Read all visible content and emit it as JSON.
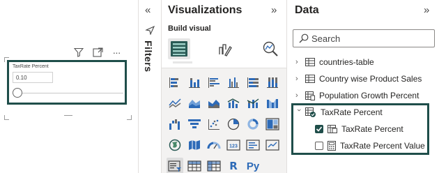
{
  "canvas": {
    "slicer_title": "TaxRate Percent",
    "slicer_value": "0.10",
    "header_icons": [
      "filter-icon",
      "focus-mode-icon",
      "more-options-icon"
    ],
    "more_glyph": "···"
  },
  "filters_pane": {
    "label": "Filters",
    "collapse_glyph": "«"
  },
  "visualizations_pane": {
    "title": "Visualizations",
    "collapse_glyph": "»",
    "build_label": "Build visual",
    "modes": [
      "build-visual-icon",
      "format-visual-icon",
      "analytics-icon"
    ],
    "gallery": [
      "stacked-bar-chart-icon",
      "stacked-column-chart-icon",
      "clustered-bar-chart-icon",
      "clustered-column-chart-icon",
      "100-stacked-bar-chart-icon",
      "100-stacked-column-chart-icon",
      "line-chart-icon",
      "area-chart-icon",
      "stacked-area-chart-icon",
      "line-clustered-column-icon",
      "line-stacked-column-icon",
      "ribbon-chart-icon",
      "waterfall-chart-icon",
      "funnel-chart-icon",
      "scatter-chart-icon",
      "pie-chart-icon",
      "donut-chart-icon",
      "treemap-icon",
      "map-icon",
      "filled-map-icon",
      "gauge-icon",
      "card-icon",
      "multi-row-card-icon",
      "kpi-icon",
      "slicer-icon",
      "table-icon",
      "matrix-icon",
      "r-visual-icon",
      "python-visual-icon"
    ],
    "r_label": "R",
    "py_label": "Py"
  },
  "data_pane": {
    "title": "Data",
    "collapse_glyph": "»",
    "search_placeholder": "Search",
    "tables": [
      {
        "name": "countries-table",
        "expanded": false
      },
      {
        "name": "Country wise Product Sales",
        "expanded": false
      },
      {
        "name": "Population Growth Percent",
        "expanded": false
      },
      {
        "name": "TaxRate Percent",
        "expanded": true
      }
    ],
    "fields": [
      {
        "name": "TaxRate Percent",
        "checked": true
      },
      {
        "name": "TaxRate Percent Value",
        "checked": false
      }
    ]
  },
  "colors": {
    "accent": "#1f4e4a",
    "focus_border": "#1f4e4a",
    "selected_check": "#1f4e4a"
  }
}
